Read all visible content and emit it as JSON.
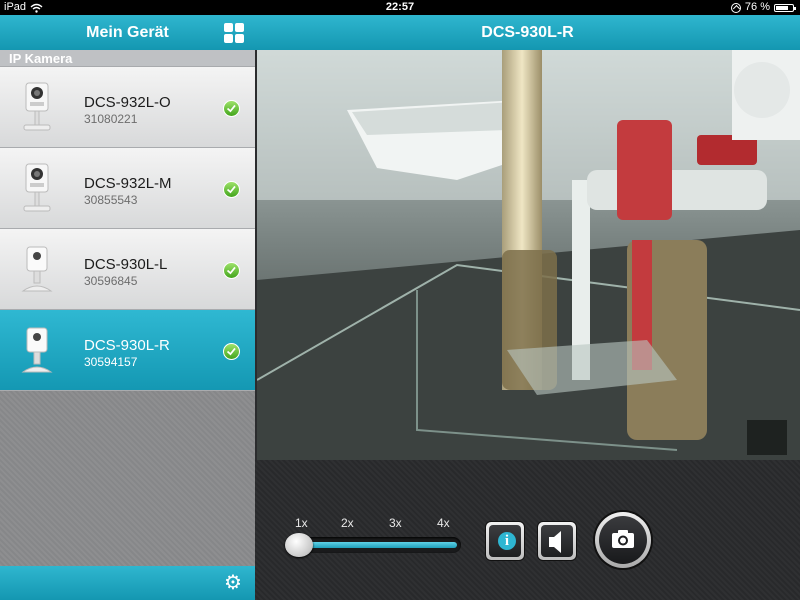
{
  "status_bar": {
    "device": "iPad",
    "time": "22:57",
    "battery": "76 %",
    "battery_level": 0.76
  },
  "sidebar": {
    "title": "Mein Gerät",
    "section_label": "IP Kamera",
    "cameras": [
      {
        "name": "DCS-932L-O",
        "id": "31080221",
        "selected": false
      },
      {
        "name": "DCS-932L-M",
        "id": "30855543",
        "selected": false
      },
      {
        "name": "DCS-930L-L",
        "id": "30596845",
        "selected": false
      },
      {
        "name": "DCS-930L-R",
        "id": "30594157",
        "selected": true
      }
    ]
  },
  "viewer": {
    "title": "DCS-930L-R",
    "zoom_levels": [
      "1x",
      "2x",
      "3x",
      "4x"
    ],
    "zoom_selected": "1x"
  },
  "colors": {
    "accent": "#1ba6c1",
    "check": "#43a51c"
  },
  "icons": {
    "grid": "grid-icon",
    "gear": "gear-icon",
    "info": "info-icon",
    "speaker": "speaker-icon",
    "camera": "camera-icon",
    "check": "check-icon",
    "wifi": "wifi-icon"
  }
}
